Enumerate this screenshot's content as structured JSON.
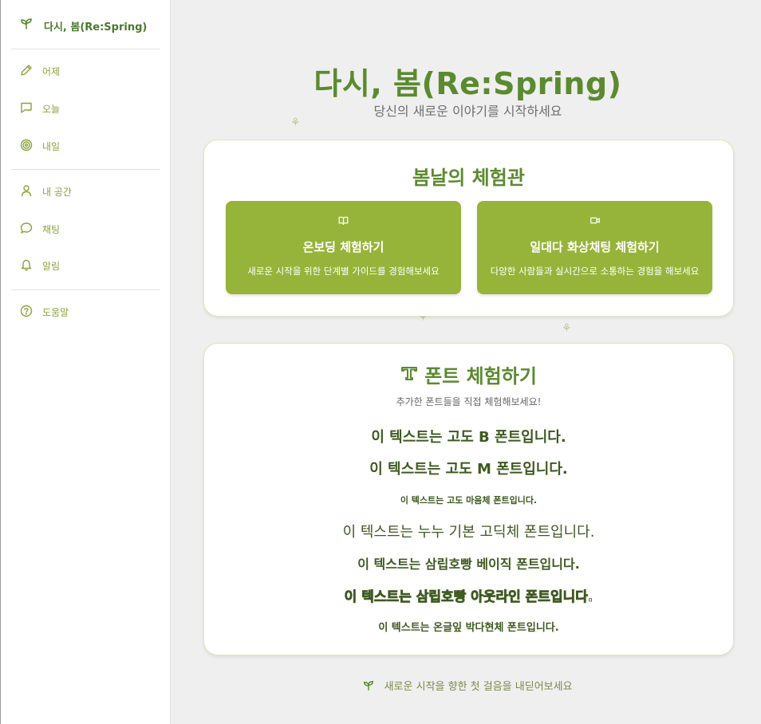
{
  "colors": {
    "brand": "#5b8a2f",
    "accent": "#96b43a",
    "nav": "#8aa33a"
  },
  "sidebar": {
    "brand": {
      "icon": "sprout-icon",
      "label": "다시, 봄(Re:Spring)"
    },
    "items": [
      {
        "icon": "pencil-icon",
        "label": "어제"
      },
      {
        "icon": "message-square-icon",
        "label": "오늘"
      },
      {
        "icon": "target-icon",
        "label": "내일"
      },
      {
        "icon": "user-icon",
        "label": "내 공간"
      },
      {
        "icon": "chat-bubble-icon",
        "label": "채팅"
      },
      {
        "icon": "bell-icon",
        "label": "알림"
      },
      {
        "icon": "help-circle-icon",
        "label": "도움말"
      }
    ]
  },
  "hero": {
    "title": "다시, 봄(Re:Spring)",
    "subtitle": "당신의 새로운 이야기를 시작하세요"
  },
  "experience": {
    "title": "봄날의 체험관",
    "cards": [
      {
        "icon": "book-open-icon",
        "title": "온보딩 체험하기",
        "desc": "새로운 시작을 위한 단계별 가이드를 경험해보세요"
      },
      {
        "icon": "video-icon",
        "title": "일대다 화상채팅 체험하기",
        "desc": "다양한 사람들과 실시간으로 소통하는 경험을 해보세요"
      }
    ]
  },
  "fonts": {
    "icon": "type-icon",
    "title": "폰트 체험하기",
    "subtitle": "추가한 폰트들을 직접 체험해보세요!",
    "samples": [
      "이 텍스트는 고도 B 폰트입니다.",
      "이 텍스트는 고도 M 폰트입니다.",
      "이 텍스트는 고도 마음체 폰트입니다.",
      "이 텍스트는 누누 기본 고딕체 폰트입니다.",
      "이 텍스트는 삼립호빵 베이직 폰트입니다.",
      "이 텍스트는 삼립호빵 아웃라인 폰트입니다.",
      "이 텍스트는 온글잎 박다현체 폰트입니다."
    ]
  },
  "footer": {
    "icon": "sprout-icon",
    "text": "새로운 시작을 향한 첫 걸음을 내딛어보세요"
  }
}
